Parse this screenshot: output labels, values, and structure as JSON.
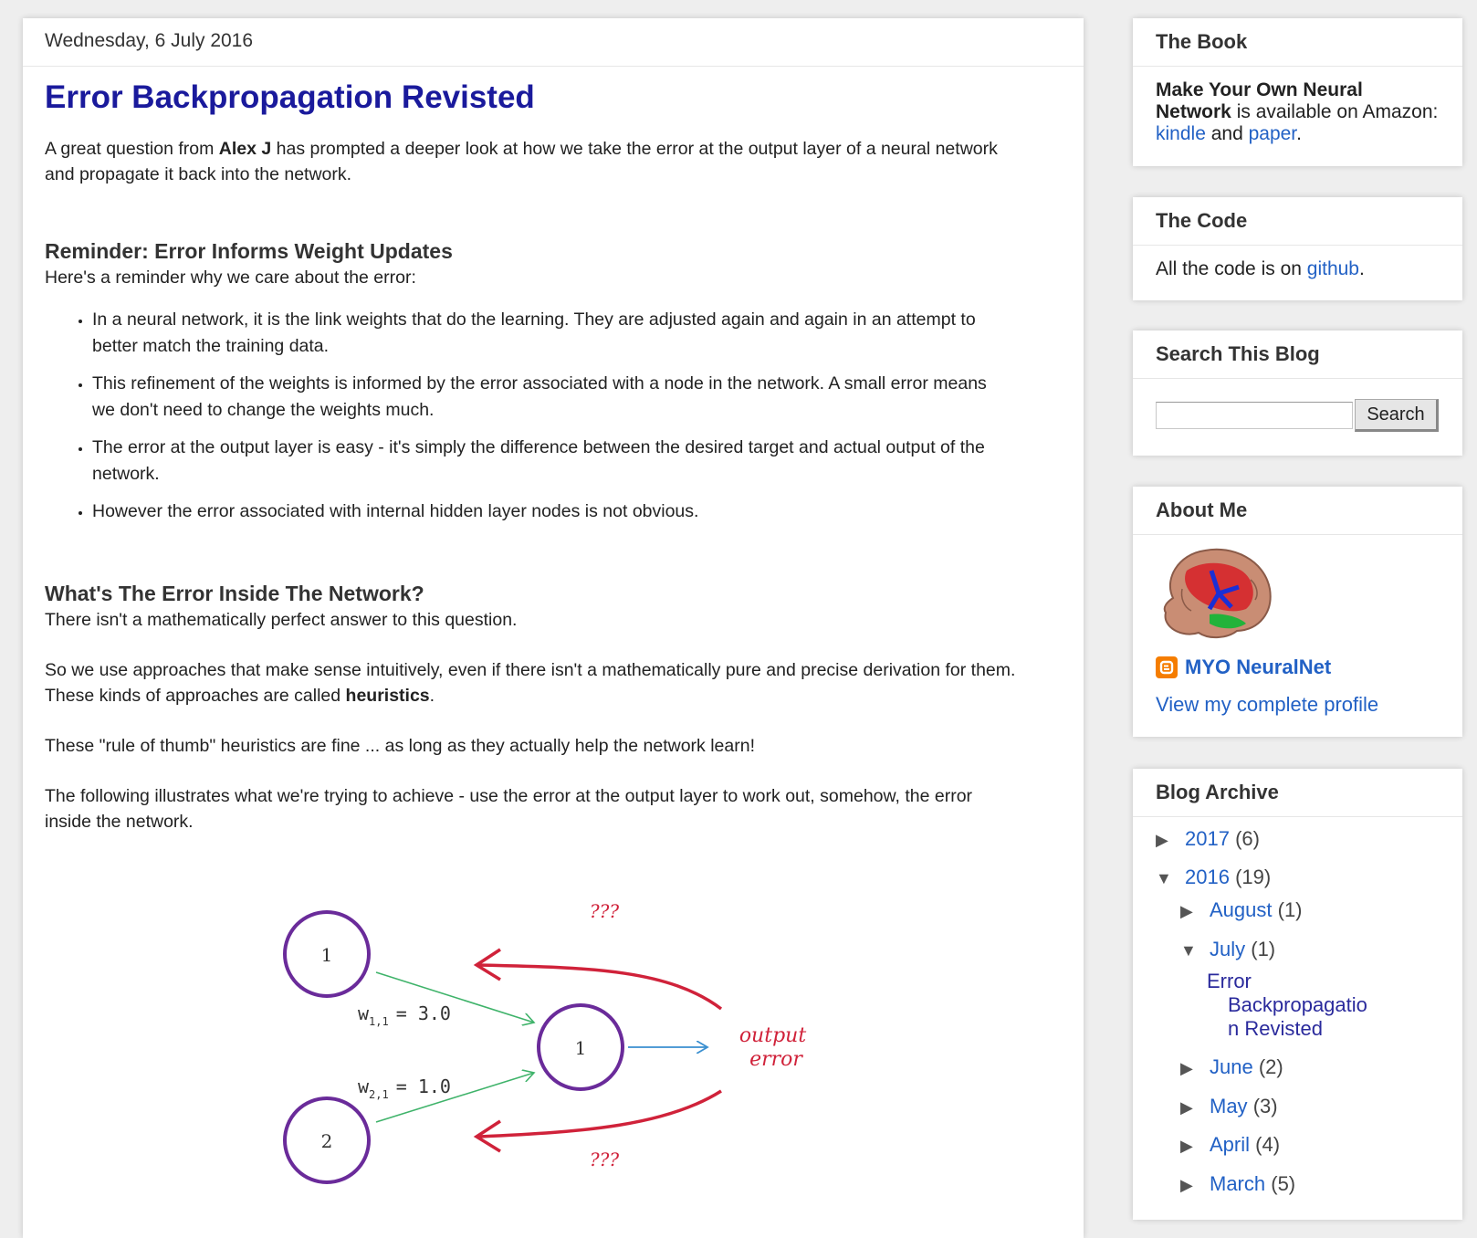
{
  "post": {
    "date": "Wednesday, 6 July 2016",
    "title": "Error Backpropagation Revisted",
    "intro_before": "A great question from ",
    "intro_bold": "Alex J",
    "intro_after": " has prompted a deeper look at how we take the error at the output layer of a neural network and propagate it back into the network.",
    "section1_heading": "Reminder: Error Informs Weight Updates",
    "section1_lead": "Here's a reminder why we care about the error:",
    "bullets": [
      "In a neural network, it is the link weights that do the learning. They are adjusted again and again in an attempt to better match the training data.",
      "This refinement of the weights is informed by the error associated with a node in the network. A small error means we don't need to change the weights much.",
      "The error at the output layer is easy - it's simply the difference between the desired target and actual output of the network.",
      "However the error associated with internal hidden layer nodes is not obvious."
    ],
    "section2_heading": "What's The Error Inside The Network?",
    "para1": "There isn't a mathematically perfect answer to this question.",
    "para2_before": "So we use approaches that make sense intuitively, even if there isn't a mathematically pure and precise derivation for them. These kinds of approaches are called ",
    "para2_bold": "heuristics",
    "para2_after": ".",
    "para3": "These \"rule of thumb\" heuristics are fine ... as long as they actually help the network learn!",
    "para4": "The following illustrates what we're trying to achieve - use the error at the output layer to work out, somehow, the error inside the network."
  },
  "diagram": {
    "node_top": "1",
    "node_bottom": "2",
    "node_middle": "1",
    "w_letter": "w",
    "w11_sub": "1,1",
    "w11_eq": "= 3.0",
    "w21_sub": "2,1",
    "w21_eq": "= 1.0",
    "question_top": "???",
    "question_bottom": "???",
    "output_line1": "output",
    "output_line2": "error",
    "colors": {
      "node": "#6a2b9a",
      "arrow_red": "#d0223a",
      "arrow_green": "#3fb36a",
      "arrow_blue": "#3a8fd0"
    }
  },
  "sidebar": {
    "book": {
      "heading": "The Book",
      "bold": "Make Your Own Neural Network",
      "text1": " is available on Amazon: ",
      "link1": "kindle",
      "text2": " and ",
      "link2": "paper",
      "text3": "."
    },
    "code": {
      "heading": "The Code",
      "text": "All the code is on ",
      "link": "github",
      "after": "."
    },
    "search": {
      "heading": "Search This Blog",
      "button": "Search",
      "placeholder": ""
    },
    "about": {
      "heading": "About Me",
      "name": "MYO NeuralNet",
      "profile_link": "View my complete profile"
    },
    "archive": {
      "heading": "Blog Archive",
      "y2017": "2017",
      "y2017_count": "(6)",
      "y2016": "2016",
      "y2016_count": "(19)",
      "august": "August",
      "august_count": "(1)",
      "july": "July",
      "july_count": "(1)",
      "post_line1": "Error",
      "post_line2": "Backpropagatio",
      "post_line3": "n Revisted",
      "june": "June",
      "june_count": "(2)",
      "may": "May",
      "may_count": "(3)",
      "april": "April",
      "april_count": "(4)",
      "march": "March",
      "march_count": "(5)"
    }
  }
}
